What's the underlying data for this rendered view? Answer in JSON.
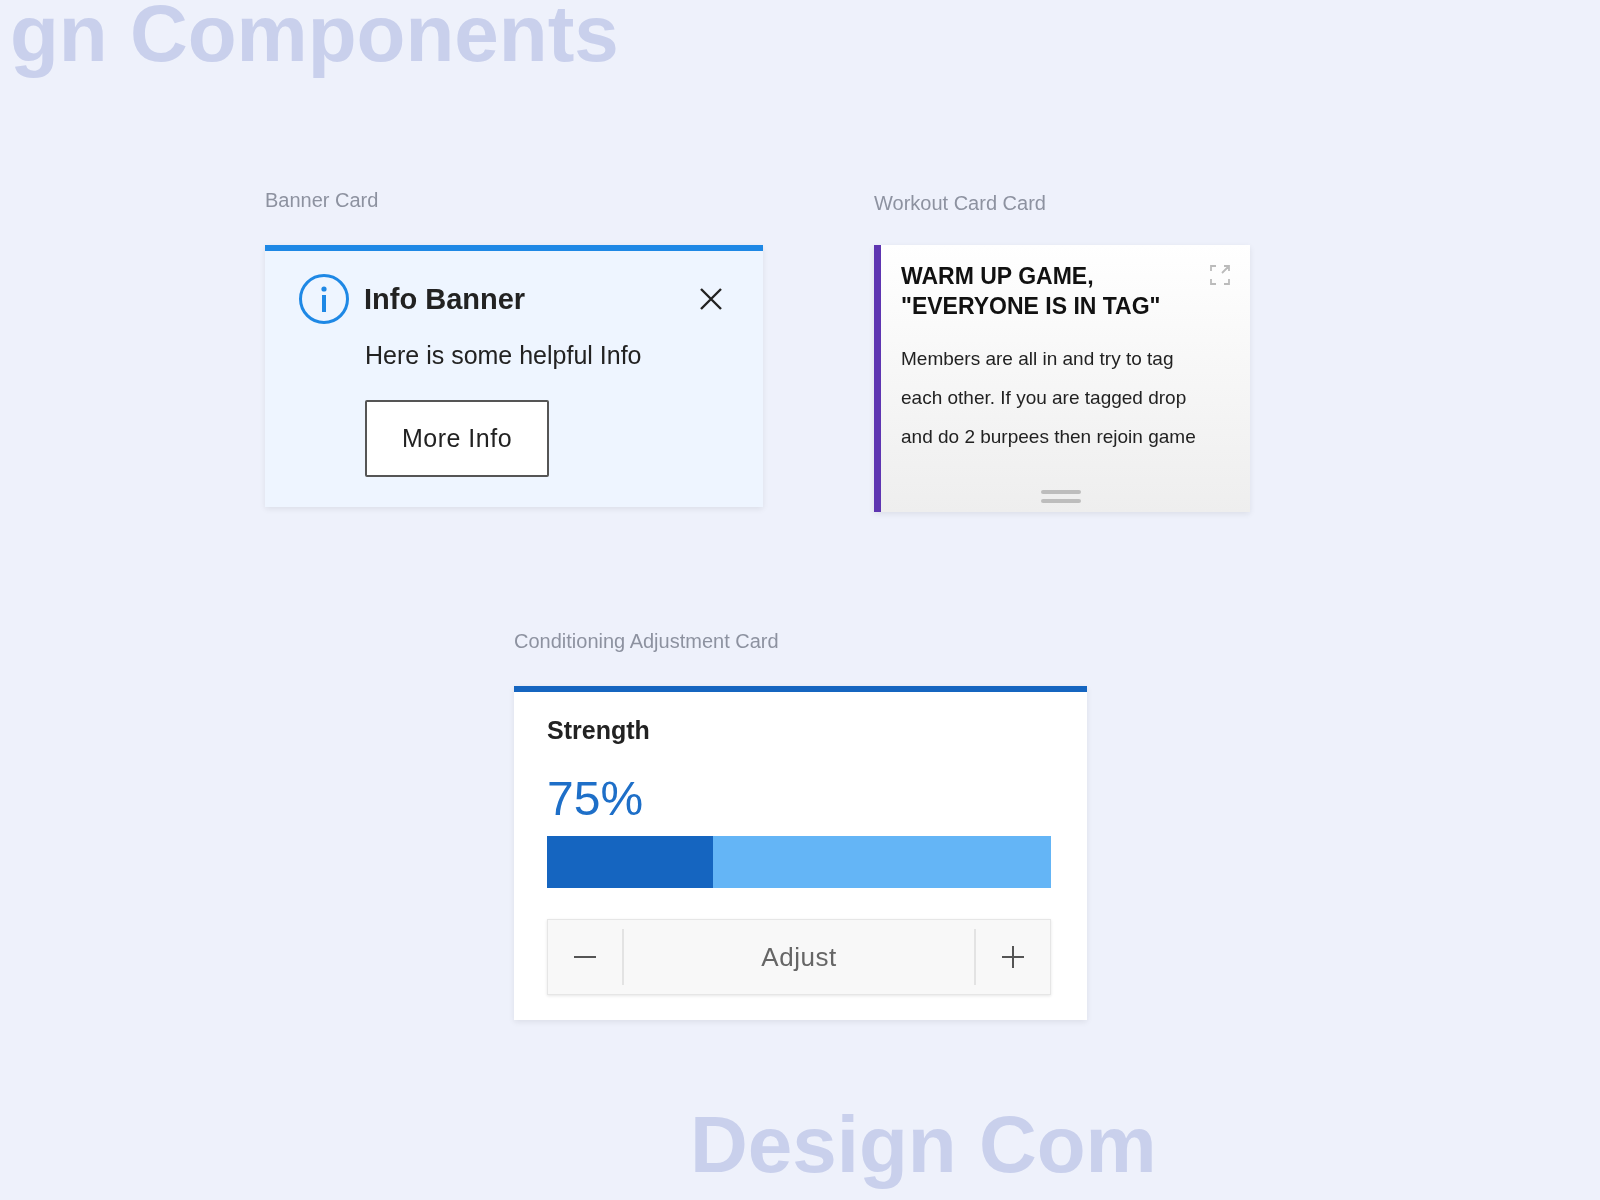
{
  "backdrop": {
    "top_text": "gn Components",
    "bottom_text": "Design Com"
  },
  "banner_section": {
    "label": "Banner Card",
    "banner": {
      "title": "Info Banner",
      "message": "Here is some helpful Info",
      "button": "More Info"
    }
  },
  "workout_section": {
    "label": "Workout Card Card",
    "card": {
      "title": "WARM UP GAME,\n\"EVERYONE IS IN TAG\"",
      "description": "Members are all in and try to tag each other. If you are tagged drop and do 2 burpees then rejoin game"
    }
  },
  "conditioning_section": {
    "label": "Conditioning Adjustment Card",
    "card": {
      "title": "Strength",
      "percent": "75%",
      "level": 0.33,
      "stepper_label": "Adjust"
    }
  }
}
